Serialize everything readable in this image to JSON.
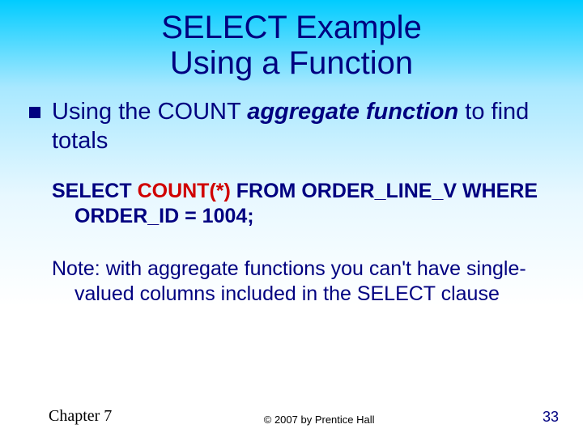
{
  "title_line1": "SELECT Example",
  "title_line2": "Using a Function",
  "bullet": {
    "pre": "Using the COUNT ",
    "emph": "aggregate function",
    "post": " to find totals"
  },
  "code": {
    "pre": "SELECT ",
    "red": "COUNT(*)",
    "post": " FROM ORDER_LINE_V WHERE ORDER_ID = 1004;"
  },
  "note": "Note: with aggregate functions you can't have single-valued columns included in the SELECT clause",
  "footer": {
    "left": "Chapter 7",
    "center": "© 2007 by Prentice Hall",
    "right": "33"
  }
}
